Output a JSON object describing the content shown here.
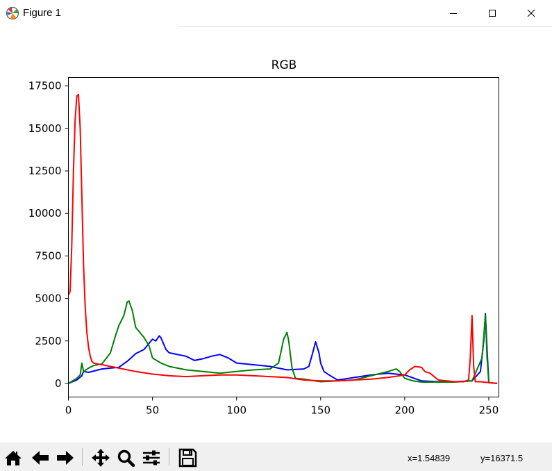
{
  "window": {
    "title": "Figure 1",
    "app_icon": "matplotlib-figure-icon",
    "controls": [
      "minimize-icon",
      "maximize-icon",
      "close-icon"
    ]
  },
  "toolbar": {
    "buttons": [
      "home-icon",
      "back-arrow-icon",
      "forward-arrow-icon",
      "pan-icon",
      "zoom-icon",
      "configure-subplots-icon",
      "save-icon"
    ],
    "coord_x": "x=1.54839",
    "coord_y": "y=16371.5"
  },
  "chart_data": {
    "type": "line",
    "title": "RGB",
    "xlabel": "",
    "ylabel": "",
    "xlim": [
      0,
      256
    ],
    "ylim": [
      -800,
      18000
    ],
    "x_ticks": [
      "0",
      "50",
      "100",
      "150",
      "200",
      "250"
    ],
    "y_ticks": [
      "0",
      "2500",
      "5000",
      "7500",
      "10000",
      "12500",
      "15000",
      "17500"
    ],
    "grid": false,
    "legend": "none",
    "series": [
      {
        "color": "#0000ff",
        "x": [
          0,
          5,
          8,
          9,
          12,
          20,
          25,
          30,
          35,
          40,
          45,
          50,
          52,
          54,
          55,
          58,
          60,
          70,
          75,
          80,
          85,
          90,
          95,
          100,
          110,
          120,
          130,
          140,
          143,
          145,
          147,
          149,
          150,
          152,
          155,
          160,
          170,
          180,
          190,
          200,
          210,
          220,
          230,
          240,
          245,
          247,
          248,
          249,
          250,
          252,
          255
        ],
        "y": [
          0,
          200,
          450,
          700,
          650,
          850,
          900,
          950,
          1300,
          1750,
          2000,
          2600,
          2500,
          2800,
          2700,
          2000,
          1800,
          1600,
          1350,
          1450,
          1600,
          1700,
          1500,
          1200,
          1100,
          1000,
          800,
          850,
          1000,
          1700,
          2450,
          1800,
          1200,
          700,
          500,
          200,
          350,
          500,
          600,
          500,
          150,
          100,
          100,
          150,
          700,
          2500,
          4100,
          2000,
          50,
          30,
          0
        ]
      },
      {
        "color": "#008000",
        "x": [
          0,
          5,
          7,
          8,
          9,
          12,
          15,
          20,
          25,
          28,
          30,
          33,
          35,
          36,
          38,
          40,
          45,
          48,
          50,
          55,
          60,
          70,
          80,
          90,
          100,
          110,
          120,
          125,
          128,
          130,
          131,
          133,
          135,
          140,
          150,
          160,
          170,
          180,
          190,
          195,
          197,
          200,
          205,
          210,
          220,
          230,
          240,
          246,
          248,
          249,
          250,
          252,
          255
        ],
        "y": [
          0,
          300,
          500,
          1200,
          700,
          900,
          1050,
          1150,
          1800,
          2800,
          3400,
          4000,
          4800,
          4850,
          4300,
          3300,
          2700,
          2200,
          1500,
          1200,
          1000,
          800,
          700,
          600,
          700,
          800,
          850,
          1200,
          2600,
          3000,
          2500,
          900,
          300,
          250,
          100,
          150,
          200,
          450,
          700,
          850,
          700,
          300,
          150,
          80,
          80,
          80,
          150,
          1500,
          4000,
          1500,
          50,
          30,
          0
        ]
      },
      {
        "color": "#ff0000",
        "x": [
          0,
          1,
          2,
          3,
          4,
          5,
          6,
          7,
          8,
          9,
          10,
          11,
          12,
          13,
          14,
          15,
          17,
          20,
          25,
          30,
          40,
          50,
          60,
          70,
          80,
          90,
          100,
          110,
          120,
          130,
          140,
          150,
          160,
          170,
          180,
          190,
          200,
          203,
          206,
          210,
          212,
          215,
          220,
          230,
          235,
          238,
          239,
          240,
          241,
          242,
          245,
          250,
          255
        ],
        "y": [
          5200,
          5400,
          8000,
          12500,
          15500,
          16900,
          17000,
          15000,
          11000,
          7000,
          4500,
          3000,
          2100,
          1600,
          1300,
          1200,
          1150,
          1100,
          1000,
          900,
          700,
          550,
          450,
          400,
          450,
          500,
          500,
          450,
          400,
          350,
          200,
          150,
          150,
          200,
          250,
          350,
          500,
          800,
          1000,
          950,
          700,
          600,
          200,
          100,
          100,
          200,
          1500,
          4000,
          1000,
          100,
          100,
          50,
          0
        ]
      }
    ]
  }
}
